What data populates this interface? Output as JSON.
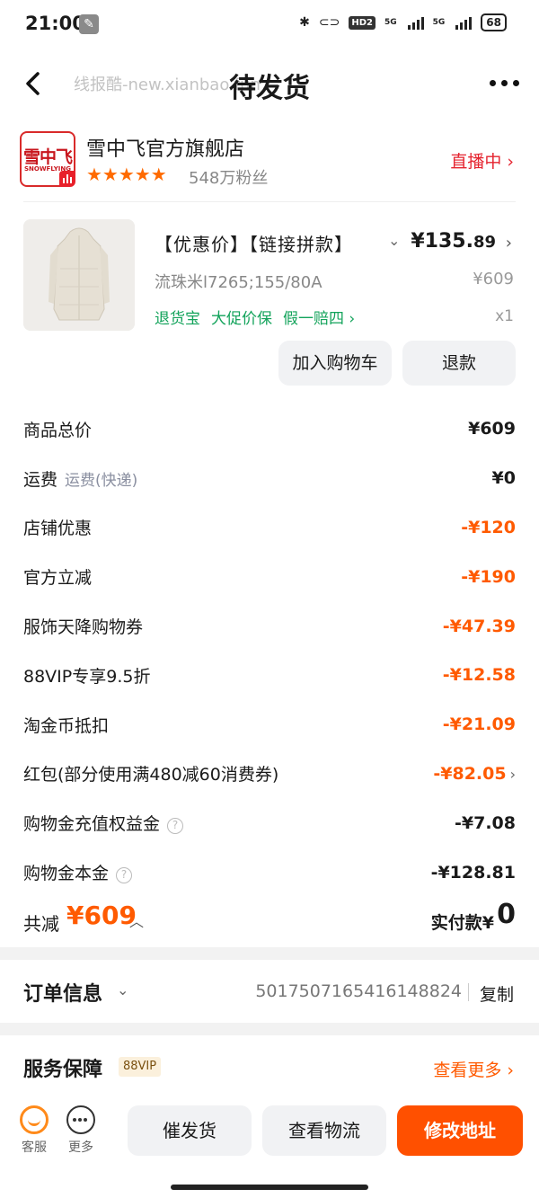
{
  "status": {
    "time": "21:00",
    "net1": "5G",
    "net2": "5G",
    "hd": "HD2",
    "battery": "68"
  },
  "nav": {
    "title": "待发货",
    "watermark": "线报酷-new.xianbao.fun"
  },
  "shop": {
    "logo_cn": "雪中飞",
    "logo_en": "SNOWFLYING",
    "name": "雪中飞官方旗舰店",
    "stars": "★★★★★",
    "fans": "548万粉丝",
    "live": "直播中 ›"
  },
  "product": {
    "title": "【优惠价】【链接拼款】",
    "price_int": "¥135.",
    "price_dec": "89",
    "spec": "流珠米l7265;155/80A",
    "orig_price": "¥609",
    "tags": [
      "退货宝",
      "大促价保",
      "假一赔四 ›"
    ],
    "qty": "x1",
    "btn_cart": "加入购物车",
    "btn_refund": "退款"
  },
  "fees": [
    {
      "label": "商品总价",
      "sub": "",
      "value": "¥609",
      "orange": false,
      "help": false,
      "chev": false
    },
    {
      "label": "运费",
      "sub": "运费(快递)",
      "value": "¥0",
      "orange": false,
      "help": false,
      "chev": false
    },
    {
      "label": "店铺优惠",
      "sub": "",
      "value": "-¥120",
      "orange": true,
      "help": false,
      "chev": false
    },
    {
      "label": "官方立减",
      "sub": "",
      "value": "-¥190",
      "orange": true,
      "help": false,
      "chev": false
    },
    {
      "label": "服饰天降购物券",
      "sub": "",
      "value": "-¥47.39",
      "orange": true,
      "help": false,
      "chev": false
    },
    {
      "label": "88VIP专享9.5折",
      "sub": "",
      "value": "-¥12.58",
      "orange": true,
      "help": false,
      "chev": false
    },
    {
      "label": "淘金币抵扣",
      "sub": "",
      "value": "-¥21.09",
      "orange": true,
      "help": false,
      "chev": false
    },
    {
      "label": "红包(部分使用满480减60消费券)",
      "sub": "",
      "value": "-¥82.05",
      "orange": true,
      "help": false,
      "chev": true
    },
    {
      "label": "购物金充值权益金",
      "sub": "",
      "value": "-¥7.08",
      "orange": false,
      "help": true,
      "chev": false
    },
    {
      "label": "购物金本金",
      "sub": "",
      "value": "-¥128.81",
      "orange": false,
      "help": true,
      "chev": false
    }
  ],
  "total": {
    "label": "共减",
    "amount": "¥609",
    "pay_label": "实付款¥",
    "pay_amount": "0"
  },
  "order": {
    "title": "订单信息",
    "number": "5017507165416148824",
    "copy": "复制"
  },
  "service": {
    "title": "服务保障",
    "badge": "88VIP",
    "more": "查看更多 ›"
  },
  "bottom": {
    "service_label": "客服",
    "more_label": "更多",
    "btn1": "催发货",
    "btn2": "查看物流",
    "btn3": "修改地址"
  },
  "colors": {
    "accent": "#ff5000",
    "green": "#13a35b",
    "live_red": "#e5242f"
  }
}
